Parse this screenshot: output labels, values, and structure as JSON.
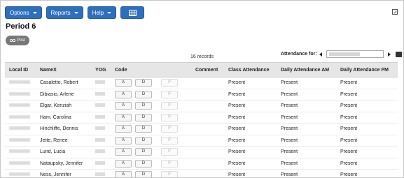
{
  "toolbar": {
    "options_label": "Options",
    "reports_label": "Reports",
    "help_label": "Help"
  },
  "page": {
    "title": "Period 6",
    "post_label": "Post",
    "records_text": "16 records"
  },
  "attendance": {
    "label": "Attendance for:",
    "date_value": ""
  },
  "table": {
    "headers": {
      "local_id": "Local ID",
      "name": "NameX",
      "yog": "YOG",
      "code": "Code",
      "comment": "Comment",
      "class_att": "Class Attendance",
      "daily_am": "Daily Attendance AM",
      "daily_pm": "Daily Attendance PM"
    },
    "code_buttons": [
      "A",
      "D",
      "P"
    ],
    "rows": [
      {
        "name": "Casaletto, Robert",
        "class_att": "Present",
        "daily_am": "Present",
        "daily_pm": "Present"
      },
      {
        "name": "Dibiasio, Arlene",
        "class_att": "Present",
        "daily_am": "Present",
        "daily_pm": "Present"
      },
      {
        "name": "Elgar, Kenziah",
        "class_att": "Present",
        "daily_am": "Present",
        "daily_pm": "Present"
      },
      {
        "name": "Ham, Carolina",
        "class_att": "Present",
        "daily_am": "Present",
        "daily_pm": "Present"
      },
      {
        "name": "Hinchliffe, Dennis",
        "class_att": "Present",
        "daily_am": "Present",
        "daily_pm": "Present"
      },
      {
        "name": "Jette, Renee",
        "class_att": "Present",
        "daily_am": "Present",
        "daily_pm": "Present"
      },
      {
        "name": "Lund, Lucia",
        "class_att": "Present",
        "daily_am": "Present",
        "daily_pm": "Present"
      },
      {
        "name": "Nataupsky, Jennifer",
        "class_att": "Present",
        "daily_am": "Present",
        "daily_pm": "Present"
      },
      {
        "name": "Ness, Jennifer",
        "class_att": "Present",
        "daily_am": "Present",
        "daily_pm": "Present"
      }
    ]
  },
  "icons": {
    "toolbar_grid": "grid-icon",
    "popout": "popout-icon",
    "post": "post-icon",
    "prev_date": "arrow-left-icon",
    "next_date": "arrow-right-icon",
    "calendar": "calendar-icon"
  },
  "colors": {
    "toolbar_button": "#2e6fbd",
    "post_button": "#777777",
    "header_bg": "#e6e6e6"
  }
}
